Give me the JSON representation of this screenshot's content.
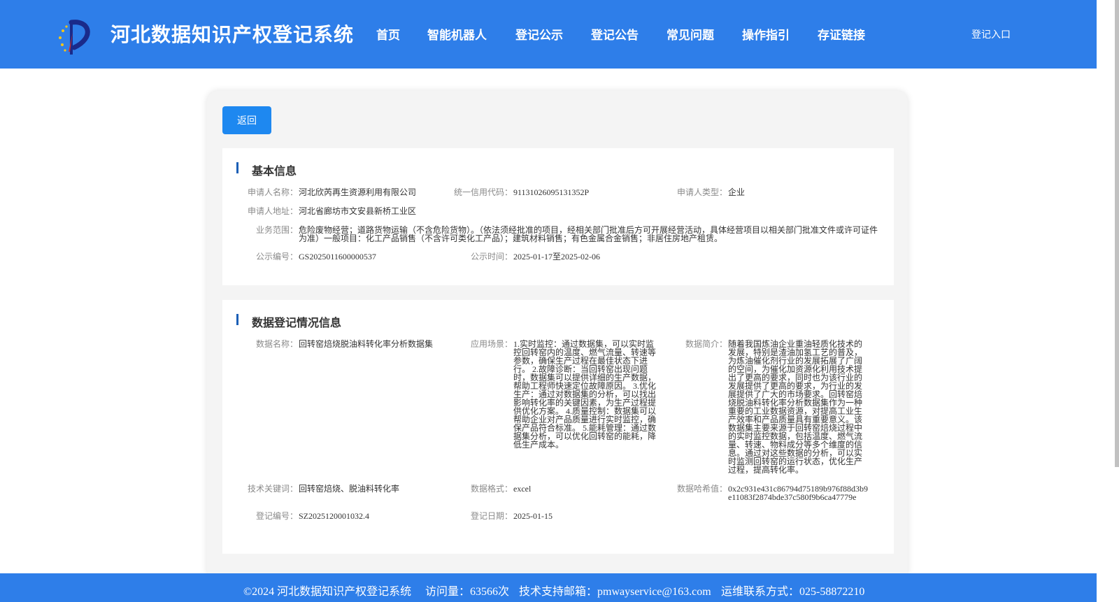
{
  "header": {
    "title": "河北数据知识产权登记系统",
    "nav": [
      "首页",
      "智能机器人",
      "登记公示",
      "登记公告",
      "常见问题",
      "操作指引",
      "存证链接"
    ],
    "login": "登记入口"
  },
  "back_button": "返回",
  "basic_info": {
    "title": "基本信息",
    "applicant_name_label": "申请人名称：",
    "applicant_name": "河北欣芮再生资源利用有限公司",
    "credit_code_label": "统一信用代码：",
    "credit_code": "91131026095131352P",
    "applicant_type_label": "申请人类型：",
    "applicant_type": "企业",
    "address_label": "申请人地址：",
    "address": "河北省廊坊市文安县新桥工业区",
    "scope_label": "业务范围：",
    "scope": "危险废物经营；道路货物运输（不含危险货物）。（依法须经批准的项目，经相关部门批准后方可开展经营活动，具体经营项目以相关部门批准文件或许可证件为准）一般项目：化工产品销售（不含许可类化工产品）；建筑材料销售；有色金属合金销售；非居住房地产租赁。",
    "notice_no_label": "公示编号：",
    "notice_no": "GS2025011600000537",
    "notice_time_label": "公示时间：",
    "notice_time": "2025-01-17至2025-02-06"
  },
  "data_info": {
    "title": "数据登记情况信息",
    "data_name_label": "数据名称：",
    "data_name": "回转窑焙烧脱油料转化率分析数据集",
    "scenario_label": "应用场景：",
    "scenario": "1.实时监控：通过数据集，可以实时监控回转窑内的温度、燃气流量、转速等参数，确保生产过程在最佳状态下进行。 2.故障诊断：当回转窑出现问题时，数据集可以提供详细的生产数据，帮助工程师快速定位故障原因。 3.优化生产：通过对数据集的分析，可以找出影响转化率的关键因素，为生产过程提供优化方案。 4.质量控制：数据集可以帮助企业对产品质量进行实时监控，确保产品符合标准。 5.能耗管理：通过数据集分析，可以优化回转窑的能耗，降低生产成本。",
    "summary_label": "数据简介：",
    "summary": "随着我国炼油企业重油轻质化技术的发展，特别是渣油加氢工艺的普及，为炼油催化剂行业的发展拓展了广阔的空间，为催化加资源化利用技术提出了更高的要求，同时也为该行业的发展提供了更高的要求，为行业的发展提供了广大的市场要求。回转窑焙烧脱油料转化率分析数据集作为一种重要的工业数据资源，对提高工业生产效率和产品质量具有重要意义。该数据集主要来源于回转窑焙烧过程中的实时监控数据，包括温度、燃气流量、转速、物料成分等多个维度的信息。通过对这些数据的分析，可以实时监测回转窑的运行状态，优化生产过程，提高转化率。",
    "keywords_label": "技术关键词：",
    "keywords": "回转窑焙烧、脱油料转化率",
    "format_label": "数据格式：",
    "format": "excel",
    "hash_label": "数据哈希值：",
    "hash": "0x2c931e431c86794d75189b976f88d3b9e11083f2874bde37c580f9b6ca47779e",
    "reg_no_label": "登记编号：",
    "reg_no": "SZ2025120001032.4",
    "reg_date_label": "登记日期：",
    "reg_date": "2025-01-15"
  },
  "footer": {
    "copyright": "©2024 河北数据知识产权登记系统",
    "visits": "访问量：63566次",
    "email": "技术支持邮箱：pmwayservice@163.com",
    "phone": "运维联系方式：025-58872210"
  },
  "colors": {
    "brand_blue": "#2e7ee9",
    "button_blue": "#1e88f0",
    "section_bar": "#1b5fb6"
  }
}
